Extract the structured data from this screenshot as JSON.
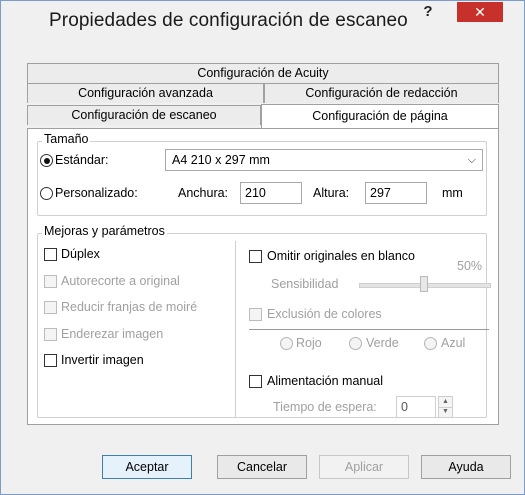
{
  "window": {
    "title": "Propiedades de configuración de escaneo",
    "help_label": "?",
    "close_label": "✕"
  },
  "tabs": {
    "row1": [
      "Configuración de Acuity"
    ],
    "row2": [
      "Configuración avanzada",
      "Configuración de redacción"
    ],
    "row3": [
      "Configuración de escaneo",
      "Configuración de página"
    ],
    "active": "Configuración de página"
  },
  "size_group": {
    "label": "Tamaño",
    "standard_label": "Estándar:",
    "standard_selected": true,
    "standard_value": "A4 210 x 297 mm",
    "custom_label": "Personalizado:",
    "custom_selected": false,
    "width_label": "Anchura:",
    "width_value": "210",
    "height_label": "Altura:",
    "height_value": "297",
    "unit_label": "mm"
  },
  "enhancements": {
    "label": "Mejoras y parámetros",
    "duplex": {
      "label": "Dúplex",
      "checked": false,
      "enabled": true
    },
    "autocrop": {
      "label": "Autorecorte a original",
      "checked": false,
      "enabled": false
    },
    "moire": {
      "label": "Reducir franjas de moiré",
      "checked": false,
      "enabled": false
    },
    "deskew": {
      "label": "Enderezar imagen",
      "checked": false,
      "enabled": false
    },
    "invert": {
      "label": "Invertir imagen",
      "checked": false,
      "enabled": true
    },
    "skip_blank": {
      "label": "Omitir originales en blanco",
      "checked": false,
      "enabled": true
    },
    "sensitivity_label": "Sensibilidad",
    "sensitivity_value": "50%",
    "sensitivity_level": 50,
    "color_dropout": {
      "label": "Exclusión de colores",
      "checked": false,
      "enabled": false
    },
    "colors": [
      "Rojo",
      "Verde",
      "Azul"
    ],
    "manual_feed": {
      "label": "Alimentación manual",
      "checked": false,
      "enabled": true
    },
    "timeout_label": "Tiempo de espera:",
    "timeout_value": "0"
  },
  "buttons": {
    "accept": "Aceptar",
    "cancel": "Cancelar",
    "apply": "Aplicar",
    "help": "Ayuda"
  },
  "colors": {
    "close_red": "#c7302b",
    "default_button_border": "#3c7fb1",
    "disabled_text": "#a0a0a0"
  }
}
